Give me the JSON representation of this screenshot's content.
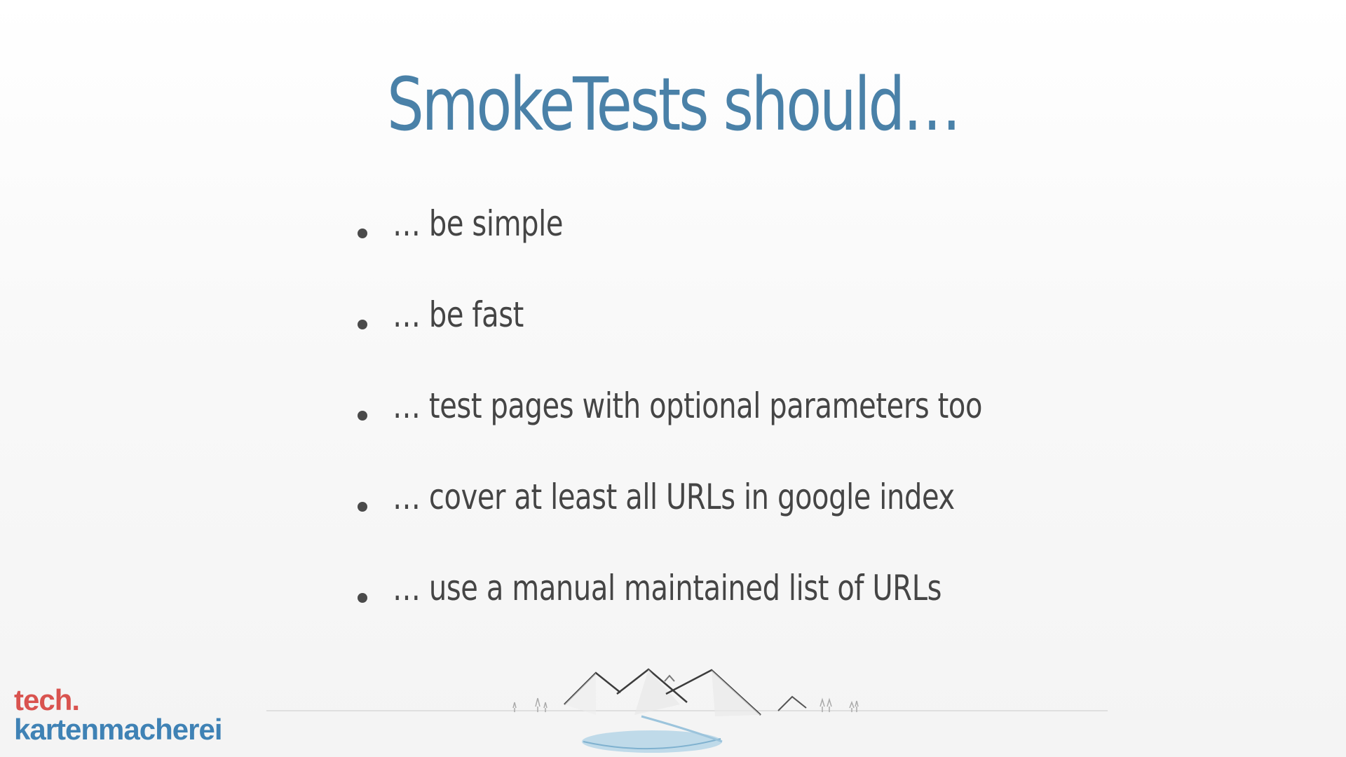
{
  "slide": {
    "title": "SmokeTests should…",
    "bullets": [
      "… be simple",
      "… be fast",
      "… test pages with optional parameters too",
      "… cover at least all URLs in google index",
      "… use a manual maintained list of URLs"
    ]
  },
  "logo": {
    "line1": "tech.",
    "line2": "kartenmacherei"
  },
  "colors": {
    "title": "#4a81a8",
    "bullet_text": "#454545",
    "logo_red": "#d9534f",
    "logo_blue": "#3f82b5"
  },
  "icons": {
    "footer": "mountain-landscape-illustration"
  }
}
